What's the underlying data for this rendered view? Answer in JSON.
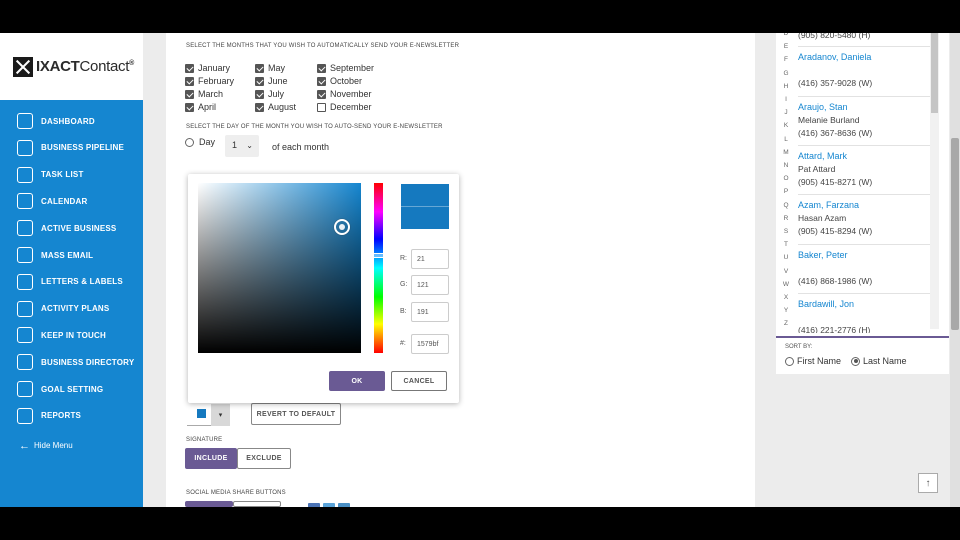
{
  "brand": {
    "name_bold": "IXACT",
    "name_light": "Contact",
    "mark": "®"
  },
  "nav": [
    {
      "label": "DASHBOARD",
      "icon": "dashboard-icon"
    },
    {
      "label": "BUSINESS PIPELINE",
      "icon": "pipeline-icon"
    },
    {
      "label": "TASK LIST",
      "icon": "task-list-icon"
    },
    {
      "label": "CALENDAR",
      "icon": "calendar-icon"
    },
    {
      "label": "ACTIVE BUSINESS",
      "icon": "active-business-icon"
    },
    {
      "label": "MASS EMAIL",
      "icon": "mass-email-icon"
    },
    {
      "label": "LETTERS & LABELS",
      "icon": "letters-labels-icon"
    },
    {
      "label": "ACTIVITY PLANS",
      "icon": "activity-plans-icon"
    },
    {
      "label": "KEEP IN TOUCH",
      "icon": "keep-in-touch-icon"
    },
    {
      "label": "BUSINESS DIRECTORY",
      "icon": "business-directory-icon"
    },
    {
      "label": "GOAL SETTING",
      "icon": "goal-setting-icon"
    },
    {
      "label": "REPORTS",
      "icon": "reports-icon"
    }
  ],
  "hide_menu": "Hide Menu",
  "newsletter": {
    "months_label": "SELECT THE MONTHS THAT YOU WISH TO AUTOMATICALLY SEND YOUR E-NEWSLETTER",
    "months": [
      {
        "name": "January",
        "checked": true
      },
      {
        "name": "February",
        "checked": true
      },
      {
        "name": "March",
        "checked": true
      },
      {
        "name": "April",
        "checked": true
      },
      {
        "name": "May",
        "checked": true
      },
      {
        "name": "June",
        "checked": true
      },
      {
        "name": "July",
        "checked": true
      },
      {
        "name": "August",
        "checked": true
      },
      {
        "name": "September",
        "checked": true
      },
      {
        "name": "October",
        "checked": true
      },
      {
        "name": "November",
        "checked": true
      },
      {
        "name": "December",
        "checked": false
      }
    ],
    "day_label": "SELECT THE DAY OF THE MONTH YOU WISH TO AUTO-SEND YOUR E-NEWSLETTER",
    "day_option": "Day",
    "day_value": "1",
    "day_suffix": "of each month",
    "revert_label": "REVERT TO DEFAULT",
    "color_value": "#1579bf",
    "signature_label": "SIGNATURE",
    "include_label": "INCLUDE",
    "exclude_label": "EXCLUDE",
    "social_label": "SOCIAL MEDIA SHARE BUTTONS"
  },
  "picker": {
    "r_label": "R:",
    "r": "21",
    "g_label": "G:",
    "g": "121",
    "b_label": "B:",
    "b": "191",
    "hex_label": "#:",
    "hex": "1579bf",
    "ok": "OK",
    "cancel": "CANCEL",
    "color": "#1579bf"
  },
  "letters": [
    "D",
    "E",
    "F",
    "G",
    "H",
    "I",
    "J",
    "K",
    "L",
    "M",
    "N",
    "O",
    "P",
    "Q",
    "R",
    "S",
    "T",
    "U",
    "V",
    "W",
    "X",
    "Y",
    "Z"
  ],
  "contacts": [
    {
      "name": "",
      "sub1": "(905) 820-5480 (H)",
      "sub2": ""
    },
    {
      "name": "Aradanov, Daniela",
      "sub1": "",
      "sub2": "(416) 357-9028 (W)"
    },
    {
      "name": "Araujo, Stan",
      "sub1": "Melanie Burland",
      "sub2": "(416) 367-8636 (W)"
    },
    {
      "name": "Attard, Mark",
      "sub1": "Pat Attard",
      "sub2": "(905) 415-8271 (W)"
    },
    {
      "name": "Azam, Farzana",
      "sub1": "Hasan Azam",
      "sub2": "(905) 415-8294 (W)"
    },
    {
      "name": "Baker, Peter",
      "sub1": "",
      "sub2": "(416) 868-1986 (W)"
    },
    {
      "name": "Bardawill, Jon",
      "sub1": "",
      "sub2": "(416) 221-2776 (H)"
    }
  ],
  "sort": {
    "label": "SORT BY:",
    "first": "First Name",
    "last": "Last Name",
    "selected": "last"
  },
  "colors": {
    "nav_blue": "#1586d0",
    "accent_purple": "#6a5a94",
    "link_blue": "#1586d0"
  }
}
